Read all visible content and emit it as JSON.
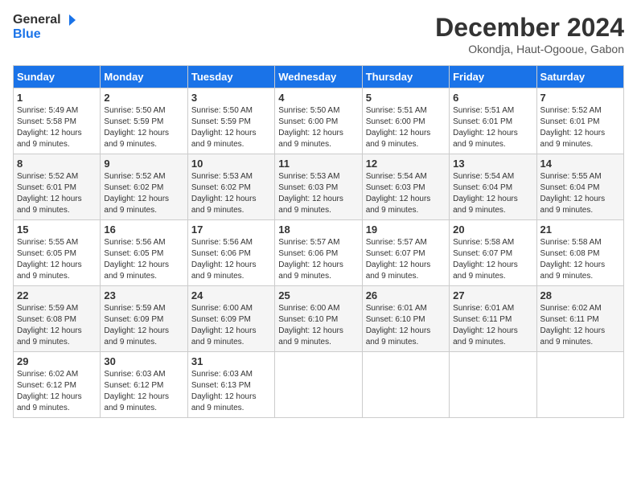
{
  "header": {
    "logo_line1": "General",
    "logo_line2": "Blue",
    "month": "December 2024",
    "location": "Okondja, Haut-Ogooue, Gabon"
  },
  "days_of_week": [
    "Sunday",
    "Monday",
    "Tuesday",
    "Wednesday",
    "Thursday",
    "Friday",
    "Saturday"
  ],
  "weeks": [
    [
      {
        "day": "1",
        "info": "Sunrise: 5:49 AM\nSunset: 5:58 PM\nDaylight: 12 hours\nand 9 minutes."
      },
      {
        "day": "2",
        "info": "Sunrise: 5:50 AM\nSunset: 5:59 PM\nDaylight: 12 hours\nand 9 minutes."
      },
      {
        "day": "3",
        "info": "Sunrise: 5:50 AM\nSunset: 5:59 PM\nDaylight: 12 hours\nand 9 minutes."
      },
      {
        "day": "4",
        "info": "Sunrise: 5:50 AM\nSunset: 6:00 PM\nDaylight: 12 hours\nand 9 minutes."
      },
      {
        "day": "5",
        "info": "Sunrise: 5:51 AM\nSunset: 6:00 PM\nDaylight: 12 hours\nand 9 minutes."
      },
      {
        "day": "6",
        "info": "Sunrise: 5:51 AM\nSunset: 6:01 PM\nDaylight: 12 hours\nand 9 minutes."
      },
      {
        "day": "7",
        "info": "Sunrise: 5:52 AM\nSunset: 6:01 PM\nDaylight: 12 hours\nand 9 minutes."
      }
    ],
    [
      {
        "day": "8",
        "info": "Sunrise: 5:52 AM\nSunset: 6:01 PM\nDaylight: 12 hours\nand 9 minutes."
      },
      {
        "day": "9",
        "info": "Sunrise: 5:52 AM\nSunset: 6:02 PM\nDaylight: 12 hours\nand 9 minutes."
      },
      {
        "day": "10",
        "info": "Sunrise: 5:53 AM\nSunset: 6:02 PM\nDaylight: 12 hours\nand 9 minutes."
      },
      {
        "day": "11",
        "info": "Sunrise: 5:53 AM\nSunset: 6:03 PM\nDaylight: 12 hours\nand 9 minutes."
      },
      {
        "day": "12",
        "info": "Sunrise: 5:54 AM\nSunset: 6:03 PM\nDaylight: 12 hours\nand 9 minutes."
      },
      {
        "day": "13",
        "info": "Sunrise: 5:54 AM\nSunset: 6:04 PM\nDaylight: 12 hours\nand 9 minutes."
      },
      {
        "day": "14",
        "info": "Sunrise: 5:55 AM\nSunset: 6:04 PM\nDaylight: 12 hours\nand 9 minutes."
      }
    ],
    [
      {
        "day": "15",
        "info": "Sunrise: 5:55 AM\nSunset: 6:05 PM\nDaylight: 12 hours\nand 9 minutes."
      },
      {
        "day": "16",
        "info": "Sunrise: 5:56 AM\nSunset: 6:05 PM\nDaylight: 12 hours\nand 9 minutes."
      },
      {
        "day": "17",
        "info": "Sunrise: 5:56 AM\nSunset: 6:06 PM\nDaylight: 12 hours\nand 9 minutes."
      },
      {
        "day": "18",
        "info": "Sunrise: 5:57 AM\nSunset: 6:06 PM\nDaylight: 12 hours\nand 9 minutes."
      },
      {
        "day": "19",
        "info": "Sunrise: 5:57 AM\nSunset: 6:07 PM\nDaylight: 12 hours\nand 9 minutes."
      },
      {
        "day": "20",
        "info": "Sunrise: 5:58 AM\nSunset: 6:07 PM\nDaylight: 12 hours\nand 9 minutes."
      },
      {
        "day": "21",
        "info": "Sunrise: 5:58 AM\nSunset: 6:08 PM\nDaylight: 12 hours\nand 9 minutes."
      }
    ],
    [
      {
        "day": "22",
        "info": "Sunrise: 5:59 AM\nSunset: 6:08 PM\nDaylight: 12 hours\nand 9 minutes."
      },
      {
        "day": "23",
        "info": "Sunrise: 5:59 AM\nSunset: 6:09 PM\nDaylight: 12 hours\nand 9 minutes."
      },
      {
        "day": "24",
        "info": "Sunrise: 6:00 AM\nSunset: 6:09 PM\nDaylight: 12 hours\nand 9 minutes."
      },
      {
        "day": "25",
        "info": "Sunrise: 6:00 AM\nSunset: 6:10 PM\nDaylight: 12 hours\nand 9 minutes."
      },
      {
        "day": "26",
        "info": "Sunrise: 6:01 AM\nSunset: 6:10 PM\nDaylight: 12 hours\nand 9 minutes."
      },
      {
        "day": "27",
        "info": "Sunrise: 6:01 AM\nSunset: 6:11 PM\nDaylight: 12 hours\nand 9 minutes."
      },
      {
        "day": "28",
        "info": "Sunrise: 6:02 AM\nSunset: 6:11 PM\nDaylight: 12 hours\nand 9 minutes."
      }
    ],
    [
      {
        "day": "29",
        "info": "Sunrise: 6:02 AM\nSunset: 6:12 PM\nDaylight: 12 hours\nand 9 minutes."
      },
      {
        "day": "30",
        "info": "Sunrise: 6:03 AM\nSunset: 6:12 PM\nDaylight: 12 hours\nand 9 minutes."
      },
      {
        "day": "31",
        "info": "Sunrise: 6:03 AM\nSunset: 6:13 PM\nDaylight: 12 hours\nand 9 minutes."
      },
      {
        "day": "",
        "info": ""
      },
      {
        "day": "",
        "info": ""
      },
      {
        "day": "",
        "info": ""
      },
      {
        "day": "",
        "info": ""
      }
    ]
  ]
}
